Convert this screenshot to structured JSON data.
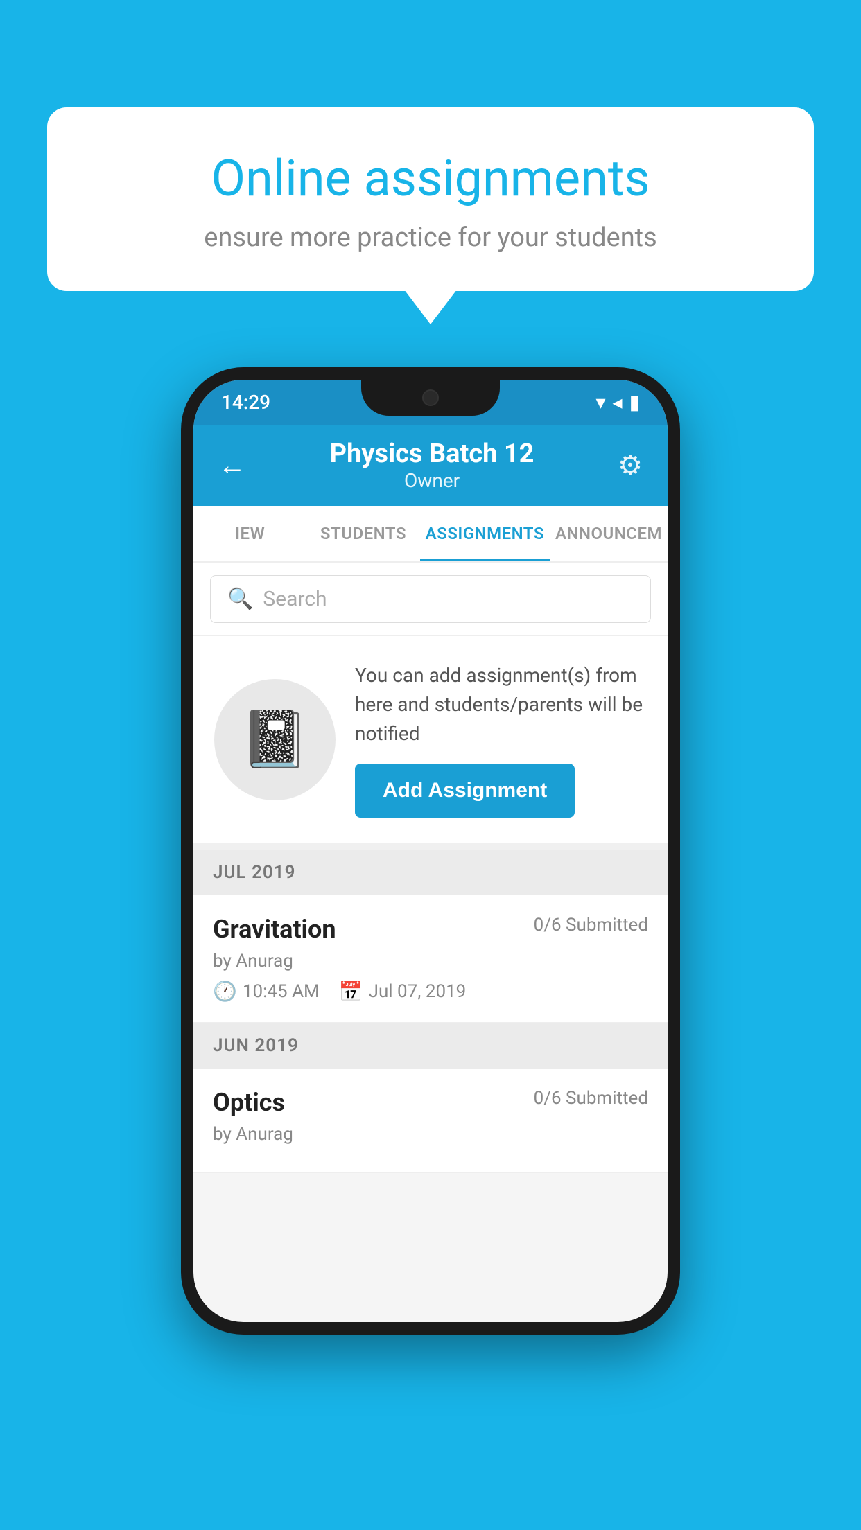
{
  "background_color": "#18b4e8",
  "speech_bubble": {
    "title": "Online assignments",
    "subtitle": "ensure more practice for your students"
  },
  "phone": {
    "status_bar": {
      "time": "14:29",
      "wifi": "▾",
      "signal": "▲",
      "battery": "▮"
    },
    "header": {
      "title": "Physics Batch 12",
      "subtitle": "Owner",
      "back_label": "←",
      "gear_label": "⚙"
    },
    "tabs": [
      {
        "label": "IEW",
        "active": false
      },
      {
        "label": "STUDENTS",
        "active": false
      },
      {
        "label": "ASSIGNMENTS",
        "active": true
      },
      {
        "label": "ANNOUNCEM",
        "active": false
      }
    ],
    "search": {
      "placeholder": "Search"
    },
    "add_assignment": {
      "info_text": "You can add assignment(s) from here and students/parents will be notified",
      "button_label": "Add Assignment"
    },
    "sections": [
      {
        "month_label": "JUL 2019",
        "assignments": [
          {
            "name": "Gravitation",
            "submitted": "0/6 Submitted",
            "by": "by Anurag",
            "time": "10:45 AM",
            "date": "Jul 07, 2019"
          }
        ]
      },
      {
        "month_label": "JUN 2019",
        "assignments": [
          {
            "name": "Optics",
            "submitted": "0/6 Submitted",
            "by": "by Anurag",
            "time": "",
            "date": ""
          }
        ]
      }
    ]
  }
}
